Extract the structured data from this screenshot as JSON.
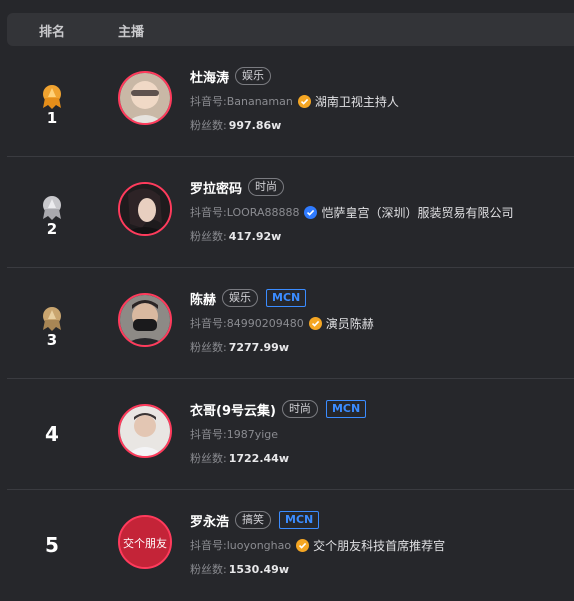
{
  "header": {
    "rank_label": "排名",
    "anchor_label": "主播"
  },
  "rows": [
    {
      "rank": "1",
      "medal": "gold",
      "name": "杜海涛",
      "category": "娱乐",
      "mcn": "",
      "douyin_id": "抖音号:Bananaman",
      "verified": "gold",
      "verify_text": "湖南卫视主持人",
      "fans_label": "粉丝数:",
      "fans_value": "997.86w"
    },
    {
      "rank": "2",
      "medal": "silver",
      "name": "罗拉密码",
      "category": "时尚",
      "mcn": "",
      "douyin_id": "抖音号:LOORA88888",
      "verified": "blue",
      "verify_text": "恺萨皇宫（深圳）服装贸易有限公司",
      "fans_label": "粉丝数:",
      "fans_value": "417.92w"
    },
    {
      "rank": "3",
      "medal": "bronze",
      "name": "陈赫",
      "category": "娱乐",
      "mcn": "MCN",
      "douyin_id": "抖音号:84990209480",
      "verified": "gold",
      "verify_text": "演员陈赫",
      "fans_label": "粉丝数:",
      "fans_value": "7277.99w"
    },
    {
      "rank": "4",
      "medal": "",
      "name": "衣哥(9号云集)",
      "category": "时尚",
      "mcn": "MCN",
      "douyin_id": "抖音号:1987yige",
      "verified": "",
      "verify_text": "",
      "fans_label": "粉丝数:",
      "fans_value": "1722.44w"
    },
    {
      "rank": "5",
      "medal": "",
      "name": "罗永浩",
      "category": "搞笑",
      "mcn": "MCN",
      "douyin_id": "抖音号:luoyonghao",
      "verified": "gold",
      "verify_text": "交个朋友科技首席推荐官",
      "fans_label": "粉丝数:",
      "fans_value": "1530.49w"
    }
  ],
  "avatar_5_text": "交个朋友",
  "colors": {
    "background": "#26272b",
    "header": "#333438",
    "avatar_ring": "#ff3b5c",
    "mcn_blue": "#3b8cff",
    "gold": "#f5a623",
    "verify_blue": "#2f7bff"
  }
}
